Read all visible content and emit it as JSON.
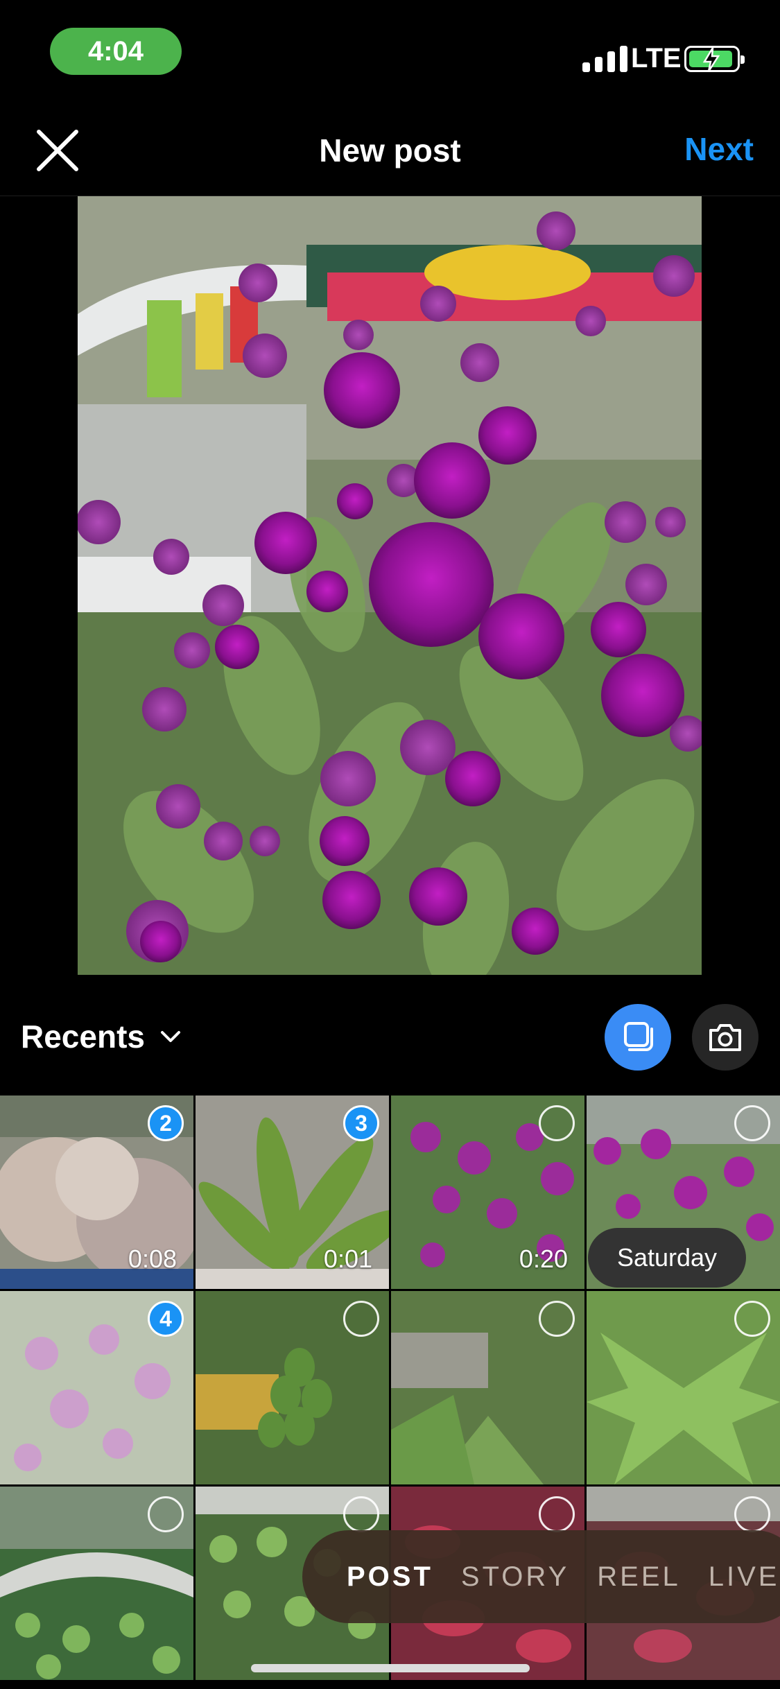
{
  "status": {
    "time": "4:04",
    "network": "LTE",
    "battery_charging": true
  },
  "header": {
    "title": "New post",
    "next": "Next",
    "close_icon": "close-icon"
  },
  "gallery": {
    "album": "Recents",
    "date_label": "Saturday",
    "items": [
      {
        "selection": "2",
        "duration": "0:08"
      },
      {
        "selection": "3",
        "duration": "0:01"
      },
      {
        "selection": "",
        "duration": "0:20"
      },
      {
        "selection": "",
        "duration": ""
      },
      {
        "selection": "4",
        "duration": ""
      },
      {
        "selection": "",
        "duration": ""
      },
      {
        "selection": "",
        "duration": ""
      },
      {
        "selection": "",
        "duration": ""
      },
      {
        "selection": "",
        "duration": ""
      },
      {
        "selection": "",
        "duration": ""
      },
      {
        "selection": "",
        "duration": ""
      },
      {
        "selection": "",
        "duration": ""
      }
    ]
  },
  "modes": {
    "post": "POST",
    "story": "STORY",
    "reel": "REEL",
    "live": "LIVE"
  },
  "colors": {
    "accent": "#1a93f5",
    "status_pill": "#4cb34c"
  }
}
